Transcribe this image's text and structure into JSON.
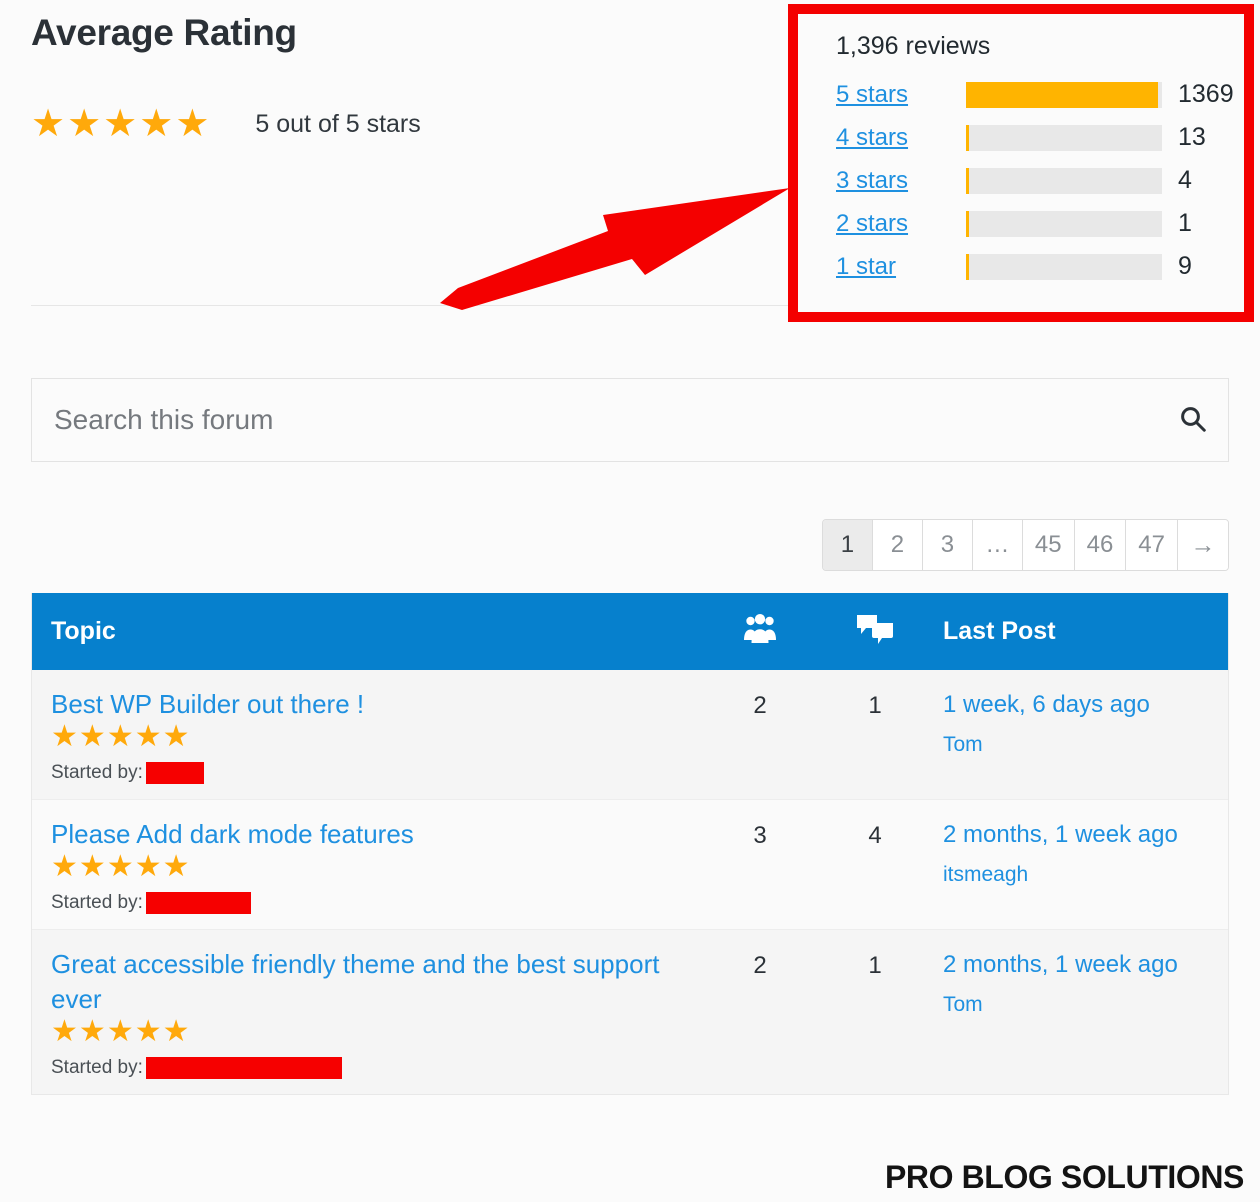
{
  "rating": {
    "title": "Average Rating",
    "stars_filled": 5,
    "summary": "5 out of 5 stars",
    "star_glyph": "★"
  },
  "histogram": {
    "total_label": "1,396 reviews",
    "highlight_color": "#f40000",
    "bar_color": "#FFB400",
    "track_color": "#e8e8e8",
    "rows": [
      {
        "label": "5 stars",
        "count": "1369",
        "pct": 98.0
      },
      {
        "label": "4 stars",
        "count": "13",
        "pct": 1.6
      },
      {
        "label": "3 stars",
        "count": "4",
        "pct": 1.6
      },
      {
        "label": "2 stars",
        "count": "1",
        "pct": 1.6
      },
      {
        "label": "1 star",
        "count": "9",
        "pct": 1.6
      }
    ]
  },
  "annotation": {
    "type": "red-arrow",
    "color": "#f40000",
    "points_to": "histogram"
  },
  "search": {
    "placeholder": "Search this forum",
    "value": "",
    "icon": "search-icon"
  },
  "pagination": {
    "items": [
      {
        "label": "1",
        "current": true
      },
      {
        "label": "2",
        "current": false
      },
      {
        "label": "3",
        "current": false
      },
      {
        "label": "…",
        "current": false
      },
      {
        "label": "45",
        "current": false
      },
      {
        "label": "46",
        "current": false
      },
      {
        "label": "47",
        "current": false
      },
      {
        "label": "→",
        "current": false
      }
    ]
  },
  "table": {
    "header": {
      "topic": "Topic",
      "voices_icon": "users-group-icon",
      "replies_icon": "comments-icon",
      "last_post": "Last Post",
      "background": "#0680CD"
    },
    "started_by_label": "Started by:",
    "rows": [
      {
        "title": "Best WP Builder out there !",
        "stars": 5,
        "author_redacted_width": 58,
        "voices": "2",
        "replies": "1",
        "last_time": "1 week, 6 days ago",
        "last_author": "Tom"
      },
      {
        "title": "Please Add dark mode features",
        "stars": 5,
        "author_redacted_width": 105,
        "voices": "3",
        "replies": "4",
        "last_time": "2 months, 1 week ago",
        "last_author": "itsmeagh"
      },
      {
        "title": "Great accessible friendly theme and the best support ever",
        "stars": 5,
        "author_redacted_width": 196,
        "voices": "2",
        "replies": "1",
        "last_time": "2 months, 1 week ago",
        "last_author": "Tom"
      }
    ]
  },
  "watermark": {
    "text": "PRO BLOG SOLUTIONS"
  }
}
